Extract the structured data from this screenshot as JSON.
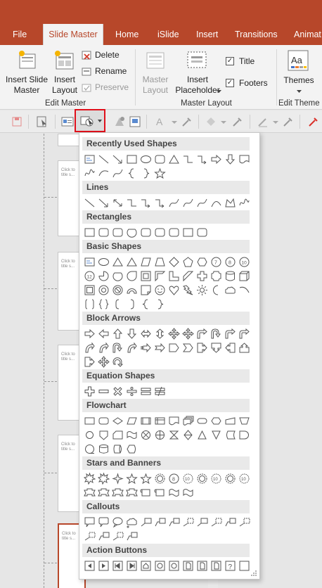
{
  "tabs": [
    {
      "label": "File",
      "active": false
    },
    {
      "label": "Slide Master",
      "active": true
    },
    {
      "label": "Home",
      "active": false
    },
    {
      "label": "iSlide",
      "active": false
    },
    {
      "label": "Insert",
      "active": false
    },
    {
      "label": "Transitions",
      "active": false
    },
    {
      "label": "Animat",
      "active": false
    }
  ],
  "ribbon": {
    "insert_slide_master": "Insert Slide\nMaster",
    "insert_layout": "Insert\nLayout",
    "delete": "Delete",
    "rename": "Rename",
    "preserve": "Preserve",
    "master_layout": "Master\nLayout",
    "insert_placeholder": "Insert\nPlaceholder",
    "title": "Title",
    "footers": "Footers",
    "themes": "Themes",
    "group_edit_master": "Edit Master",
    "group_master_layout": "Master Layout",
    "group_edit_theme": "Edit Theme",
    "title_checked": true,
    "footers_checked": true
  },
  "thumbnails": {
    "text": "Click to\ntitle s..."
  },
  "shapes_menu": {
    "sections": [
      {
        "name": "Recently Used Shapes"
      },
      {
        "name": "Lines"
      },
      {
        "name": "Rectangles"
      },
      {
        "name": "Basic Shapes"
      },
      {
        "name": "Block Arrows"
      },
      {
        "name": "Equation Shapes"
      },
      {
        "name": "Flowchart"
      },
      {
        "name": "Stars and Banners"
      },
      {
        "name": "Callouts"
      },
      {
        "name": "Action Buttons"
      }
    ]
  },
  "colors": {
    "accent": "#b7472a",
    "highlight": "#e0101b"
  }
}
